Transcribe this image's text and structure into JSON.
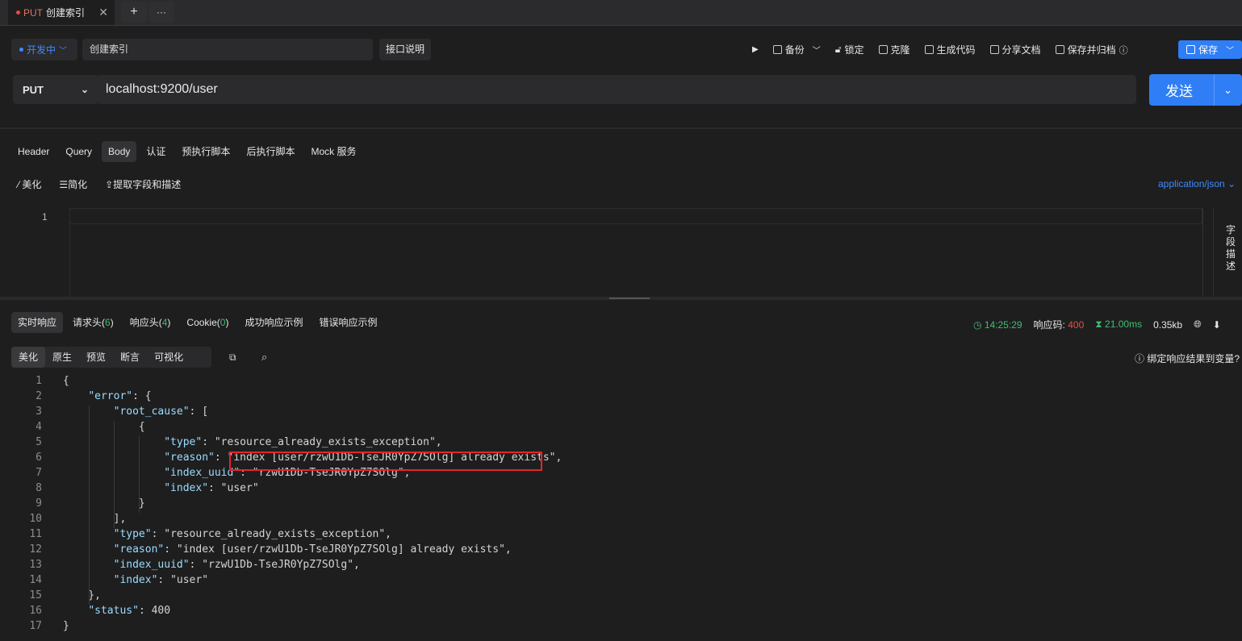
{
  "tab": {
    "method": "PUT",
    "title": "创建索引",
    "close": "✕",
    "add": "+",
    "more": "···"
  },
  "env": {
    "label": "开发中"
  },
  "request_name": "创建索引",
  "doc_button": "接口说明",
  "toolbar": {
    "backup": "备份",
    "lock": "锁定",
    "clone": "克隆",
    "gencode": "生成代码",
    "share": "分享文档",
    "save_archive": "保存并归档",
    "save": "保存"
  },
  "request": {
    "method": "PUT",
    "url": "localhost:9200/user",
    "send": "发送"
  },
  "req_tabs": [
    "Header",
    "Query",
    "Body",
    "认证",
    "预执行脚本",
    "后执行脚本",
    "Mock 服务"
  ],
  "req_active": "Body",
  "body_tools": {
    "beautify": "美化",
    "simplify": "简化",
    "extract": "提取字段和描述",
    "content_type": "application/json"
  },
  "editor": {
    "line1": "1",
    "side_label": "字段描述"
  },
  "resp_tabs": {
    "live": "实时响应",
    "req_headers": "请求头",
    "req_headers_count": "6",
    "resp_headers": "响应头",
    "resp_headers_count": "4",
    "cookie": "Cookie",
    "cookie_count": "0",
    "success_example": "成功响应示例",
    "error_example": "错误响应示例"
  },
  "status": {
    "time": "14:25:29",
    "code_label": "响应码:",
    "code": "400",
    "duration": "21.00ms",
    "size": "0.35kb"
  },
  "view_tabs": [
    "美化",
    "原生",
    "预览",
    "断言",
    "可视化"
  ],
  "bind_label": "绑定响应结果到变量?",
  "colors": {
    "accent": "#2f7ef5",
    "error_box": "#e8232a",
    "status_error": "#e0534a",
    "status_ok": "#3fbf6f"
  },
  "code_lines": [
    "{",
    "    \"error\": {",
    "        \"root_cause\": [",
    "            {",
    "                \"type\": \"resource_already_exists_exception\",",
    "                \"reason\": \"index [user/rzwU1Db-TseJR0YpZ7SOlg] already exists\",",
    "                \"index_uuid\": \"rzwU1Db-TseJR0YpZ7SOlg\",",
    "                \"index\": \"user\"",
    "            }",
    "        ],",
    "        \"type\": \"resource_already_exists_exception\",",
    "        \"reason\": \"index [user/rzwU1Db-TseJR0YpZ7SOlg] already exists\",",
    "        \"index_uuid\": \"rzwU1Db-TseJR0YpZ7SOlg\",",
    "        \"index\": \"user\"",
    "    },",
    "    \"status\": 400",
    "}"
  ]
}
